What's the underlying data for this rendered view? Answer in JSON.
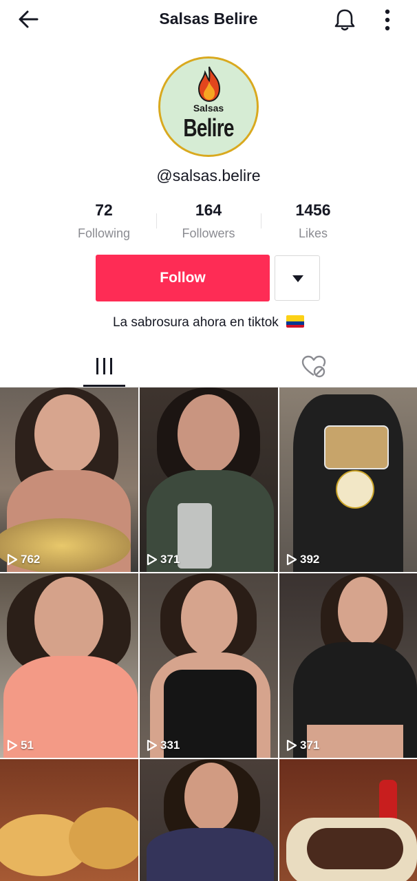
{
  "header": {
    "title": "Salsas Belire",
    "back_icon": "arrow-left-icon",
    "bell_icon": "bell-icon",
    "more_icon": "more-vertical-icon"
  },
  "profile": {
    "avatar_brand_top": "Salsas",
    "avatar_brand_main": "Belire",
    "handle": "@salsas.belire",
    "bio": "La sabrosura ahora en tiktok",
    "bio_flag": "colombia-flag-icon"
  },
  "stats": [
    {
      "value": "72",
      "label": "Following"
    },
    {
      "value": "164",
      "label": "Followers"
    },
    {
      "value": "1456",
      "label": "Likes"
    }
  ],
  "actions": {
    "follow_label": "Follow",
    "dropdown_icon": "caret-down-icon"
  },
  "tabs": {
    "videos_icon": "grid-bars-icon",
    "liked_icon": "hidden-heart-icon",
    "active": "videos"
  },
  "videos": [
    {
      "views": "762"
    },
    {
      "views": "371"
    },
    {
      "views": "392"
    },
    {
      "views": "51"
    },
    {
      "views": "331"
    },
    {
      "views": "371"
    },
    {
      "views": ""
    },
    {
      "views": ""
    },
    {
      "views": ""
    }
  ],
  "colors": {
    "follow_red": "#fe2c55",
    "text_primary": "#161823",
    "text_secondary": "#8a8b91"
  }
}
